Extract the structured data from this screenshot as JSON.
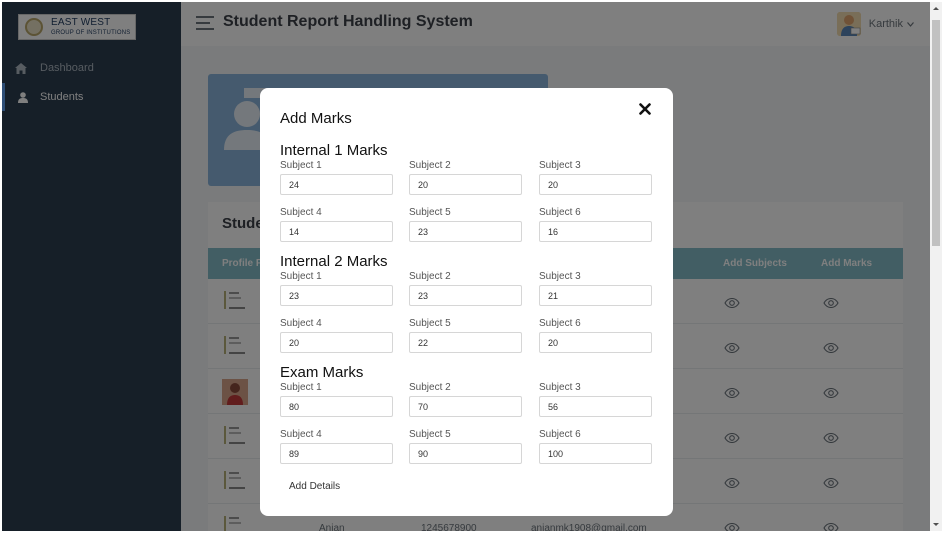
{
  "brand": {
    "name_line1": "EAST WEST",
    "name_line2": "GROUP OF INSTITUTIONS"
  },
  "sidebar": {
    "items": [
      {
        "label": "Dashboard",
        "icon": "home-icon",
        "active": false
      },
      {
        "label": "Students",
        "icon": "user-icon",
        "active": true
      }
    ]
  },
  "header": {
    "title": "Student Report Handling System",
    "user_name": "Karthik",
    "user_menu_icon": "chevron-down-icon"
  },
  "main": {
    "card_title": "Stude",
    "table": {
      "headers": [
        "Profile P",
        "Add Subjects",
        "Add Marks"
      ],
      "partial_row": {
        "name": "Anjan",
        "phone": "1245678900",
        "email": "anjanmk1908@gmail.com"
      }
    }
  },
  "modal": {
    "title": "Add Marks",
    "close_icon": "close-icon",
    "sections": [
      {
        "title": "Internal 1 Marks",
        "fields": [
          {
            "label": "Subject 1",
            "value": "24"
          },
          {
            "label": "Subject 2",
            "value": "20"
          },
          {
            "label": "Subject 3",
            "value": "20"
          },
          {
            "label": "Subject 4",
            "value": "14"
          },
          {
            "label": "Subject 5",
            "value": "23"
          },
          {
            "label": "Subject 6",
            "value": "16"
          }
        ]
      },
      {
        "title": "Internal 2 Marks",
        "fields": [
          {
            "label": "Subject 1",
            "value": "23"
          },
          {
            "label": "Subject 2",
            "value": "23"
          },
          {
            "label": "Subject 3",
            "value": "21"
          },
          {
            "label": "Subject 4",
            "value": "20"
          },
          {
            "label": "Subject 5",
            "value": "22"
          },
          {
            "label": "Subject 6",
            "value": "20"
          }
        ]
      },
      {
        "title": "Exam Marks",
        "fields": [
          {
            "label": "Subject 1",
            "value": "80"
          },
          {
            "label": "Subject 2",
            "value": "70"
          },
          {
            "label": "Subject 3",
            "value": "56"
          },
          {
            "label": "Subject 4",
            "value": "89"
          },
          {
            "label": "Subject 5",
            "value": "90"
          },
          {
            "label": "Subject 6",
            "value": "100"
          }
        ]
      }
    ],
    "submit_label": "Add Details"
  },
  "colors": {
    "sidebar_bg": "#2c3e50",
    "table_header_bg": "#84bdc9",
    "banner_bg": "#8bb5dc",
    "overlay": "rgba(0,0,0,0.5)"
  }
}
